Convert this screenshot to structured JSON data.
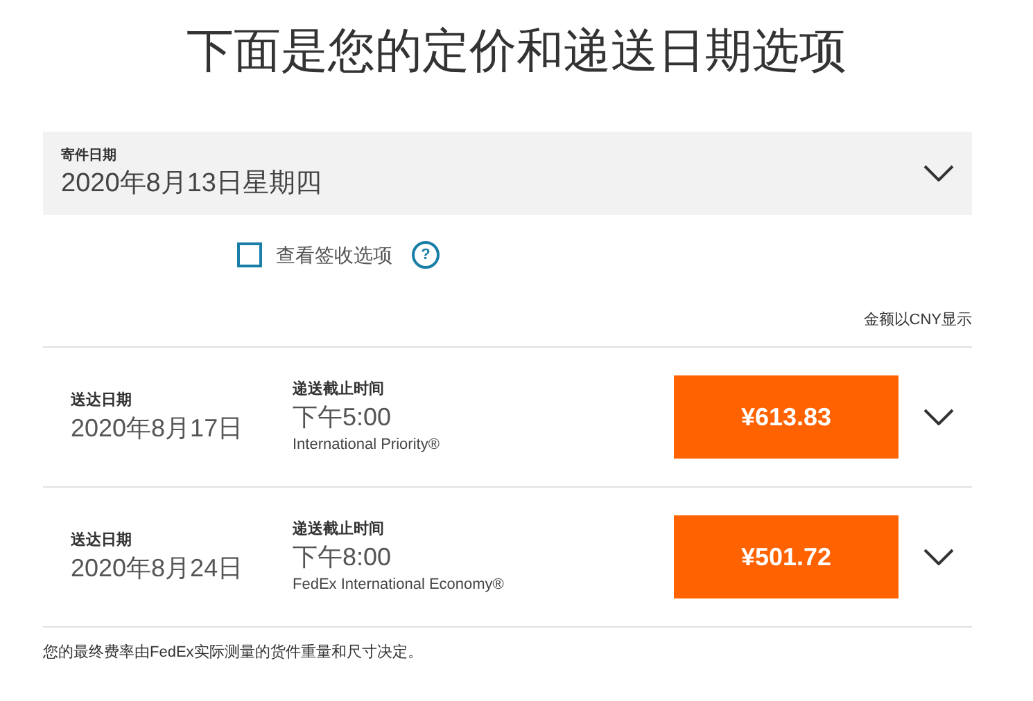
{
  "title": "下面是您的定价和递送日期选项",
  "ship_date": {
    "label": "寄件日期",
    "value": "2020年8月13日星期四"
  },
  "signature_option": {
    "label": "查看签收选项",
    "checked": false,
    "help": "?"
  },
  "currency_note": "金额以CNY显示",
  "rates": [
    {
      "date_label": "送达日期",
      "date": "2020年8月17日",
      "time_label": "递送截止时间",
      "time": "下午5:00",
      "service": "International Priority®",
      "price": "¥613.83",
      "expanded": false
    },
    {
      "date_label": "送达日期",
      "date": "2020年8月24日",
      "time_label": "递送截止时间",
      "time": "下午8:00",
      "service": "FedEx International Economy®",
      "price": "¥501.72",
      "expanded": false
    }
  ],
  "footnote": "您的最终费率由FedEx实际测量的货件重量和尺寸决定。"
}
